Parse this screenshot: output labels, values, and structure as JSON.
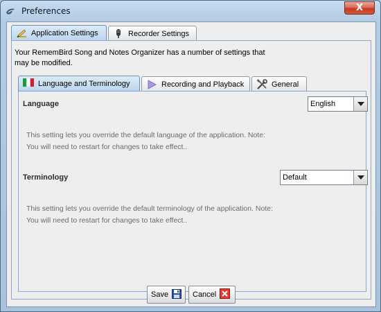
{
  "window": {
    "title": "Preferences",
    "close_symbol": "X"
  },
  "outer_tabs": [
    {
      "label": "Application Settings",
      "icon": "pen-icon",
      "active": true
    },
    {
      "label": "Recorder Settings",
      "icon": "microphone-icon",
      "active": false
    }
  ],
  "description": "Your RememBird Song and Notes Organizer has a number of settings that may be modified.",
  "inner_tabs": [
    {
      "label": "Language and Terminology",
      "icon": "italy-flag-icon",
      "active": true
    },
    {
      "label": "Recording and Playback",
      "icon": "play-icon",
      "active": false
    },
    {
      "label": "General",
      "icon": "tools-icon",
      "active": false
    }
  ],
  "language": {
    "label": "Language",
    "value": "English",
    "help_line1": "This setting lets you override the default language of the application. Note:",
    "help_line2": "You will need to restart for changes to take effect.."
  },
  "terminology": {
    "label": "Terminology",
    "value": "Default",
    "help_line1": "This setting lets you override the default terminology of the application. Note:",
    "help_line2": "You will need to restart for changes to take effect.."
  },
  "buttons": {
    "save": "Save",
    "cancel": "Cancel"
  },
  "colors": {
    "title_bar": "#b3cbe4",
    "close_red": "#c53a22",
    "tab_active": "#b9d4ef",
    "panel_border": "#8aa8c6",
    "help_text": "#6b6b6b"
  }
}
